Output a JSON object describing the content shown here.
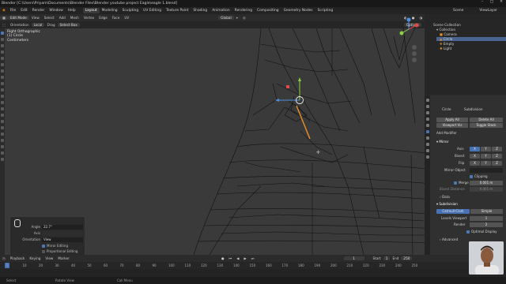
{
  "window": {
    "title": "Blender [C:\\Users\\Priyam\\Documents\\Blender Files\\Blender youtube project Eagle\\eagle 1.blend]"
  },
  "menu": {
    "items": [
      "File",
      "Edit",
      "Render",
      "Window",
      "Help"
    ]
  },
  "workspaces": {
    "items": [
      "Layout",
      "Modeling",
      "Sculpting",
      "UV Editing",
      "Texture Paint",
      "Shading",
      "Animation",
      "Rendering",
      "Compositing",
      "Geometry Nodes",
      "Scripting"
    ],
    "active": "Layout"
  },
  "top_right": {
    "scene": "Scene",
    "view_layer": "ViewLayer"
  },
  "header": {
    "mode": "Edit Mode",
    "menus": [
      "View",
      "Select",
      "Add",
      "Mesh",
      "Vertex",
      "Edge",
      "Face",
      "UV"
    ],
    "transform": "Global",
    "options": "Options"
  },
  "toolsettings": {
    "orientation_label": "Orientation",
    "orientation_value": "Local",
    "drag_label": "Drag",
    "drag_value": "Select Box"
  },
  "viewport": {
    "line1": "Right Orthographic",
    "line2": "(1) Circle",
    "line3": "Centimeters"
  },
  "op_panel": {
    "angle_label": "Angle",
    "angle_value": "22.7°",
    "axis_label": "Axis",
    "orientation_label": "Orientation",
    "orientation_value": "View",
    "mirror_editing": "Mirror Editing",
    "proportional_editing": "Proportional Editing"
  },
  "outliner": {
    "header": "Scene Collection",
    "items": [
      "Collection",
      "Camera",
      "Circle",
      "Empty",
      "Light"
    ],
    "selected": "Circle"
  },
  "properties": {
    "object": "Circle",
    "modifier_root": "Subdivision",
    "apply_all": "Apply All",
    "delete_all": "Delete All",
    "viewport_vis": "Viewport Vis",
    "toggle_stack": "Toggle Stack",
    "add_modifier": "Add Modifier",
    "mirror": {
      "name": "Mirror",
      "axis_label": "Axis",
      "bisect_label": "Bisect",
      "flip_label": "Flip",
      "xyz": [
        "X",
        "Y",
        "Z"
      ],
      "mirror_object": "Mirror Object",
      "clipping": "Clipping",
      "merge_label": "Merge",
      "merge_value": "0.001 m",
      "bisect_distance": "Bisect Distance",
      "bisect_value": "0.001 m",
      "data": "Data"
    },
    "subdiv": {
      "name": "Subdivision",
      "catmull": "Catmull-Clark",
      "simple": "Simple",
      "levels_viewport": "Levels Viewport",
      "levels_viewport_value": "1",
      "render": "Render",
      "render_value": "2",
      "optimal_display": "Optimal Display",
      "advanced": "Advanced"
    }
  },
  "timeline": {
    "playback": "Playback",
    "keying": "Keying",
    "view": "View",
    "marker": "Marker",
    "current": "1",
    "start_label": "Start",
    "start": "1",
    "end_label": "End",
    "end": "250",
    "ticks": [
      "0",
      "10",
      "20",
      "30",
      "40",
      "50",
      "60",
      "70",
      "80",
      "90",
      "100",
      "110",
      "120",
      "130",
      "140",
      "150",
      "160",
      "170",
      "180",
      "190",
      "200",
      "210",
      "220",
      "230",
      "240",
      "250"
    ]
  },
  "status": {
    "left": "Select",
    "mid": "Rotate View",
    "right": "Call Menu"
  },
  "colors": {
    "accent": "#4772b3",
    "viewport": "#3a3a3a",
    "mesh": "#0c0c0c",
    "gizmo_x": "#e04a4a",
    "gizmo_y": "#8bd048",
    "gizmo_z": "#4b8ee0"
  }
}
